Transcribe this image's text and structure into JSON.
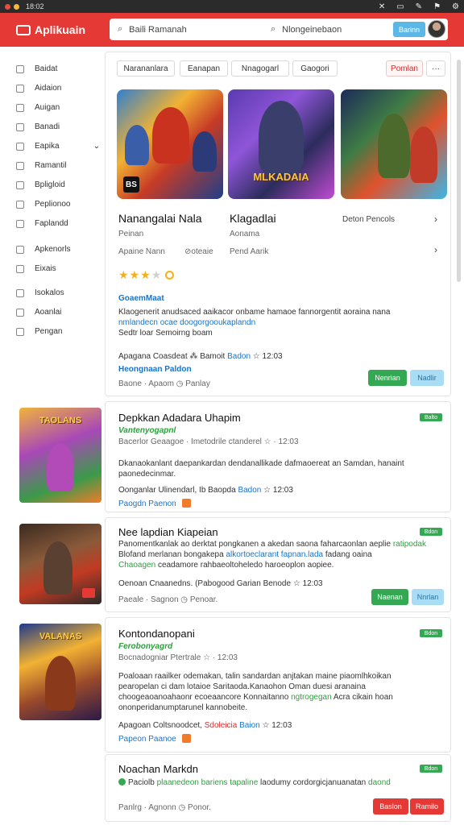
{
  "system": {
    "time": "18:02"
  },
  "app": {
    "name": "Aplikuain"
  },
  "search": {
    "left": "Baili Ramanah",
    "right": "Nlongeinebaon",
    "button": "Barinn"
  },
  "sidebar": {
    "items": [
      {
        "label": "Baidat",
        "icon": "grid-icon"
      },
      {
        "label": "Aidaion",
        "icon": "clock-icon"
      },
      {
        "label": "Auigan",
        "icon": "bell-icon"
      },
      {
        "label": "Banadi",
        "icon": "doc-icon"
      },
      {
        "label": "Eapika",
        "icon": "folder-icon",
        "chevron": "⌄"
      },
      {
        "label": "Ramantil",
        "icon": "triangle-icon"
      },
      {
        "label": "Bpligloid",
        "icon": "list-icon"
      },
      {
        "label": "Peplionoo",
        "icon": "book-icon"
      },
      {
        "label": "Faplandd",
        "icon": "box-icon"
      },
      {
        "label": "Apkenorls",
        "icon": "pin-icon"
      },
      {
        "label": "Eixais",
        "icon": "chat-icon"
      },
      {
        "label": "Isokalos",
        "icon": "tag-icon"
      },
      {
        "label": "Aoanlai",
        "icon": "user-icon"
      },
      {
        "label": "Pengan",
        "icon": "settings-icon"
      }
    ]
  },
  "filters": {
    "chips": [
      "Narananlara",
      "Eanapan",
      "Nnagogarl",
      "Gaogori"
    ],
    "action": "Pomlan",
    "more": "···"
  },
  "featured": {
    "tiles": [
      {
        "badge": "BS",
        "logo": ""
      },
      {
        "badge": "",
        "logo": "MLKADAIA"
      },
      {
        "badge": "",
        "logo": ""
      }
    ],
    "title1": "Nanangalai Nala",
    "title2": "Klagadlai",
    "side_title": "Deton Pencols",
    "sub1": "Peinan",
    "sub2": "Aonama",
    "meta1": "Apaine Nann",
    "meta2": "⊘oteaie",
    "meta3": "Pend Aarik",
    "rating": 3,
    "rating_max": 4,
    "section_title": "GoaemMaat",
    "desc": "Klaogenerit anudsaced aaikacor onbame hamaoe fannorgentit aoraina nana",
    "desc_link": "nmlandecn ocae doogorgooukaplandn",
    "desc_more": "Sedtr loar Semoirng boam",
    "info": "Apagana Coasdeat",
    "info_b": "Bamoit",
    "info_c": "Badon",
    "info_d": "12:03",
    "link": "Heongnaan Paldon",
    "footer_a": "Baone",
    "footer_b": "Apaom",
    "footer_c": "Panlay",
    "btn_primary": "Nenrian",
    "btn_secondary": "Nadlir"
  },
  "cards": [
    {
      "thumb_label": "TAOLANS",
      "title": "Depkkan Adadara Uhapim",
      "subtitle": "Vantenyogapnl",
      "meta": "Bacerlor Geaagoe · Imetodrile ctanderel ☆ · 12:03",
      "tag": "Balto",
      "desc": "Dkanaokanlant daepankardan dendanallikade dafmaoereat an Samdan, hanaint",
      "desc2": "paonedecinmar.",
      "info": "Oonganlar Ulinendarl, Ib Baopda",
      "info_b": "Badon",
      "info_c": "12:03",
      "foot_a": "Paogdn",
      "foot_b": "Paenon"
    },
    {
      "thumb_label": "",
      "title": "Nee lapdian Kiapeian",
      "subtitle": "",
      "meta": "",
      "tag": "Bdon",
      "desc": "Panomentkanlak ao derktat pongkanen a akedan saona faharcaonlan aeplie",
      "desc_hl": "ratipodak",
      "desc2": "Blofand merlanan bongakepa",
      "desc2_hl": "alkortoeclarant fapnan.lada",
      "desc2_tail": "fadang oaina",
      "desc3_hl": "Chaoagen",
      "desc3": "ceadamore rahbaeoltoheledo haroeoplon aopiee.",
      "info": "Oenoan Cnaanedns. (Pabogood Garian",
      "info_b": "Benode",
      "info_c": "12:03",
      "foot_a": "Paeale",
      "foot_b": "Sagnon",
      "foot_c": "Penoar.",
      "btn_primary": "Naenan",
      "btn_secondary": "Nnrlan"
    },
    {
      "thumb_label": "VALANAS",
      "title": "Kontondanopani",
      "subtitle": "Ferobonyagrd",
      "meta": "Bocnadogniar Ptertrale ☆ · 12:03",
      "tag": "Bdon",
      "desc": "Poaloaan raailker odemakan, talin sandardan anjtakan maine piaomlhkoikan",
      "desc2": "pearopelan ci dam lotaioe Saritaoda.Kanaohon Oman duesi aranaina",
      "desc3": "choogeaoanoahaonr ecoeaancore Konnaitanno",
      "desc3_hl": "ngtrogegan",
      "desc3_tail": "Acra cikain hoan",
      "desc4": "ononperidanumptarunel kannobeite.",
      "info": "Apagoan Coltsnoodcet,",
      "info_hl": "Sdoleicia",
      "info_b": "Baion",
      "info_c": "12:03",
      "foot_a": "Papeon",
      "foot_b": "Paanoe"
    },
    {
      "title": "Noachan Markdn",
      "tag": "Bdon",
      "desc_pre": "Paciolb",
      "desc_hl": "plaanedeon bariens tapaline",
      "desc_tail": "laodumy cordorgicjanuanatan",
      "desc_end": "daond",
      "foot_a": "Panlrg",
      "foot_b": "Agnonn",
      "foot_c": "Ponor.",
      "btn_primary": "Baslon",
      "btn_secondary": "Ramilo"
    }
  ],
  "colors": {
    "brand": "#e53935",
    "link": "#1a73c9",
    "success": "#34a853"
  }
}
